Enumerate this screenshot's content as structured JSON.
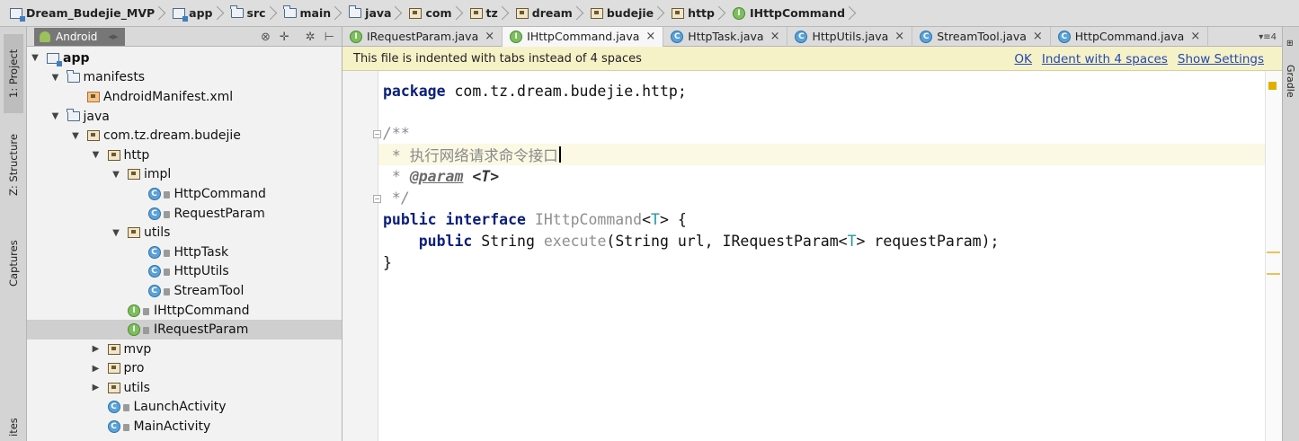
{
  "breadcrumb": [
    "Dream_Budejie_MVP",
    "app",
    "src",
    "main",
    "java",
    "com",
    "tz",
    "dream",
    "budejie",
    "http",
    "IHttpCommand"
  ],
  "left_strip": {
    "tabs": [
      "1: Project",
      "Z: Structure",
      "Captures",
      "ites"
    ]
  },
  "project_panel": {
    "view_mode": "Android",
    "tree": [
      {
        "label": "app",
        "depth": 0,
        "expanded": true,
        "icon": "module-icon",
        "bold": true
      },
      {
        "label": "manifests",
        "depth": 1,
        "expanded": true,
        "icon": "folder-icon"
      },
      {
        "label": "AndroidManifest.xml",
        "depth": 2,
        "icon": "manifest-icon"
      },
      {
        "label": "java",
        "depth": 1,
        "expanded": true,
        "icon": "folder-icon"
      },
      {
        "label": "com.tz.dream.budejie",
        "depth": 2,
        "expanded": true,
        "icon": "package-icon"
      },
      {
        "label": "http",
        "depth": 3,
        "expanded": true,
        "icon": "package-icon"
      },
      {
        "label": "impl",
        "depth": 4,
        "expanded": true,
        "icon": "package-icon"
      },
      {
        "label": "HttpCommand",
        "depth": 5,
        "icon": "class-icon"
      },
      {
        "label": "RequestParam",
        "depth": 5,
        "icon": "class-icon"
      },
      {
        "label": "utils",
        "depth": 4,
        "expanded": true,
        "icon": "package-icon"
      },
      {
        "label": "HttpTask",
        "depth": 5,
        "icon": "class-icon"
      },
      {
        "label": "HttpUtils",
        "depth": 5,
        "icon": "class-icon"
      },
      {
        "label": "StreamTool",
        "depth": 5,
        "icon": "class-icon"
      },
      {
        "label": "IHttpCommand",
        "depth": 4,
        "icon": "interface-icon"
      },
      {
        "label": "IRequestParam",
        "depth": 4,
        "icon": "interface-icon",
        "selected": true
      },
      {
        "label": "mvp",
        "depth": 3,
        "expanded": false,
        "icon": "package-icon"
      },
      {
        "label": "pro",
        "depth": 3,
        "expanded": false,
        "icon": "package-icon"
      },
      {
        "label": "utils",
        "depth": 3,
        "expanded": false,
        "icon": "package-icon"
      },
      {
        "label": "LaunchActivity",
        "depth": 3,
        "icon": "class-icon"
      },
      {
        "label": "MainActivity",
        "depth": 3,
        "icon": "class-icon"
      }
    ]
  },
  "editor": {
    "tabs": [
      {
        "label": "IRequestParam.java",
        "icon": "interface-icon",
        "active": false
      },
      {
        "label": "IHttpCommand.java",
        "icon": "interface-icon",
        "active": true
      },
      {
        "label": "HttpTask.java",
        "icon": "class-icon",
        "active": false
      },
      {
        "label": "HttpUtils.java",
        "icon": "class-icon",
        "active": false
      },
      {
        "label": "StreamTool.java",
        "icon": "class-icon",
        "active": false
      },
      {
        "label": "HttpCommand.java",
        "icon": "class-icon",
        "active": false
      }
    ],
    "tabs_overflow": "4",
    "notice": {
      "message": "This file is indented with tabs instead of 4 spaces",
      "ok": "OK",
      "indent": "Indent with 4 spaces",
      "settings": "Show Settings"
    },
    "code": {
      "l1_kw": "package",
      "l1_rest": " com.tz.dream.budejie.http;",
      "l3": "/**",
      "l4": " * 执行网络请求命令接口",
      "l5_star": " * ",
      "l5_tag": "@param",
      "l5_sp": " ",
      "l5_param": "<T>",
      "l6": " */",
      "l7_kw1": "public",
      "l7_sp1": " ",
      "l7_kw2": "interface",
      "l7_sp2": " ",
      "l7_name": "IHttpCommand",
      "l7_lt": "<",
      "l7_t": "T",
      "l7_gt": "> {",
      "l8_indent": "    ",
      "l8_kw": "public",
      "l8_type": " String ",
      "l8_method": "execute",
      "l8_args1": "(String url, IRequestParam<",
      "l8_t": "T",
      "l8_args2": "> requestParam);",
      "l9": "}"
    }
  },
  "right_strip": {
    "tab": "Gradle"
  },
  "colors": {
    "notice_bg": "#f6f2c8",
    "link": "#2447b4",
    "keyword": "#0b1f7a",
    "comment": "#8a8a8a",
    "generic": "#20999d"
  }
}
